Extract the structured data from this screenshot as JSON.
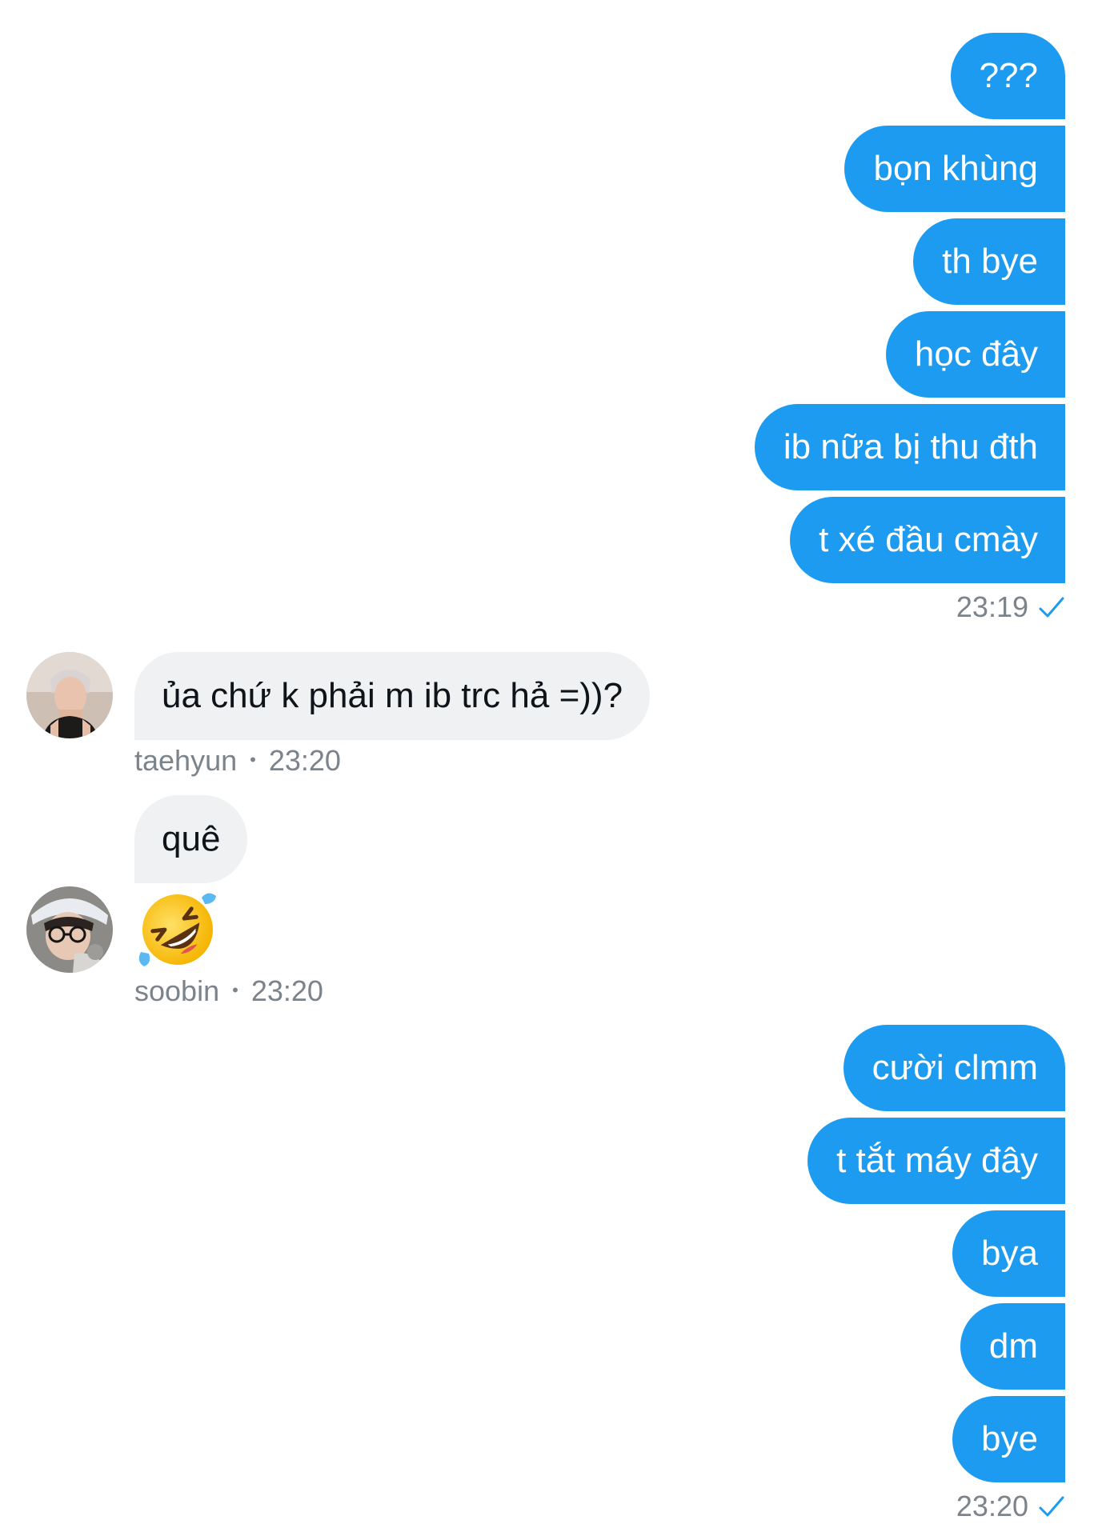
{
  "conversation": {
    "outgoing_group_1": {
      "messages": [
        "???",
        "bọn khùng",
        "th bye",
        "học đây",
        "ib nữa bị thu đth",
        "t xé đầu cmày"
      ],
      "time": "23:19"
    },
    "incoming_taehyun": {
      "message": "ủa chứ k phải m ib trc hả =))?",
      "sender": "taehyun",
      "separator": "•",
      "time": "23:20"
    },
    "incoming_soobin": {
      "message": "quê",
      "emoji": "rolling-on-floor-laughing-emoji",
      "sender": "soobin",
      "separator": "•",
      "time": "23:20"
    },
    "outgoing_group_2": {
      "messages": [
        "cười clmm",
        "t tắt máy đây",
        "bya",
        "dm",
        "bye"
      ],
      "time": "23:20"
    }
  },
  "colors": {
    "outgoing_bubble": "#1d9bf0",
    "incoming_bubble": "#eff1f3",
    "meta_text": "#7b838b",
    "read_check": "#1d9bf0"
  }
}
